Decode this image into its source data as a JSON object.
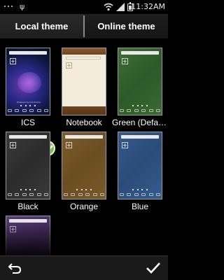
{
  "status_bar": {
    "time": "11:32AM",
    "usb_symbol": "ψ",
    "icons": [
      "notification-dots-icon",
      "usb-icon",
      "wifi-icon",
      "signal-icon",
      "battery-icon"
    ]
  },
  "tabs": [
    {
      "label": "Local theme",
      "selected": true
    },
    {
      "label": "Online theme",
      "selected": false
    }
  ],
  "themes": [
    {
      "name": "ICS",
      "selected": true,
      "accent": "#2b2a8a"
    },
    {
      "name": "Notebook",
      "selected": false,
      "accent": "#f3ebdc"
    },
    {
      "name": "Green (Default)",
      "selected": false,
      "accent": "#2c5a29"
    },
    {
      "name": "Black",
      "selected": false,
      "accent": "#2b2b2b"
    },
    {
      "name": "Orange",
      "selected": false,
      "accent": "#6a4d22"
    },
    {
      "name": "Blue",
      "selected": false,
      "accent": "#2a4c79"
    },
    {
      "name": "",
      "selected": false,
      "accent": "#4a2e66"
    }
  ],
  "preview": {
    "ics_caption": "Powered by ICS theme",
    "plus_symbol": "+"
  },
  "bottom_bar": {
    "back_icon": "back-arrow-icon",
    "confirm_icon": "checkmark-icon"
  },
  "colors": {
    "tab_indicator": "#5b3fa6",
    "selected_check": "#79c256"
  }
}
